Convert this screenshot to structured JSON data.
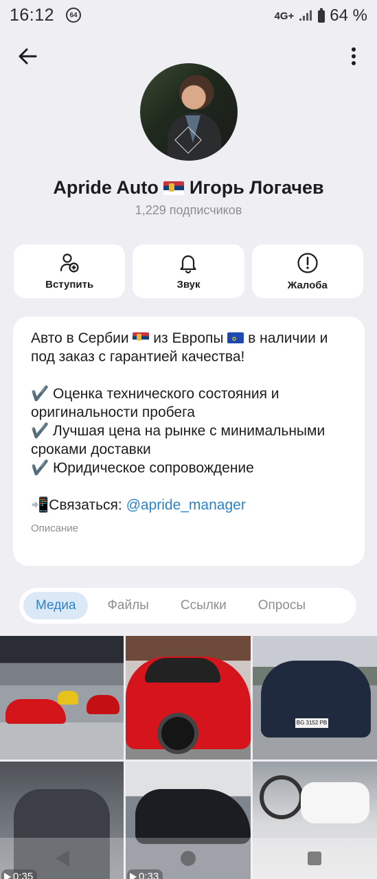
{
  "status_bar": {
    "time": "16:12",
    "badge": "64",
    "network": "4G+",
    "battery_percent": "64 %"
  },
  "icons": {
    "back": "arrow-left-icon",
    "more": "more-vertical-icon",
    "join": "add-person-icon",
    "sound": "bell-icon",
    "report": "exclamation-circle-icon"
  },
  "channel": {
    "name_part1": "Apride Auto",
    "name_part2": "Игорь Логачев",
    "subscribers": "1,229 подписчиков"
  },
  "actions": {
    "join": "Вступить",
    "sound": "Звук",
    "report": "Жалоба"
  },
  "description": {
    "line1a": "Авто в Сербии",
    "line1b": "из Европы",
    "line1c": "в наличии и под заказ с гарантией качества!",
    "bullet1": "✔️ Оценка технического состояния и оригинальности пробега",
    "bullet2": "✔️ Лучшая цена на рынке с минимальными сроками доставки",
    "bullet3": "✔️ Юридическое сопровождение",
    "contact_prefix": "📲Связаться: ",
    "contact_link": "@apride_manager",
    "caption": "Описание"
  },
  "tabs": [
    "Медиа",
    "Файлы",
    "Ссылки",
    "Опросы"
  ],
  "media": {
    "durations": [
      "0:35",
      "0:33"
    ],
    "plate": "BG 3152 PB"
  },
  "colors": {
    "accent": "#2b83c8",
    "background": "#efeff3",
    "card": "#ffffff",
    "tab_active_bg": "#dbe9f7"
  }
}
